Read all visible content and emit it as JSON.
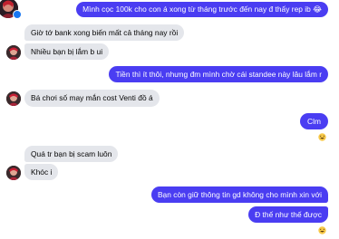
{
  "colors": {
    "outgoing": "#4a3df2",
    "incoming": "#e4e6eb",
    "incoming_text": "#050505",
    "outgoing_text": "#ffffff"
  },
  "messages": [
    {
      "side": "out",
      "text": "Mình cọc 100k cho con á xong từ tháng trước đến nay đ thấy rep ib 😂"
    },
    {
      "side": "in",
      "text": "Giờ tớ bank xong biến mất cả tháng nay rồi"
    },
    {
      "side": "in",
      "text": "Nhiều bạn bị lắm b ui"
    },
    {
      "side": "out",
      "text": "Tiền thì ít thôi, nhưng đm mình chờ cái standee này lâu lắm r"
    },
    {
      "side": "in",
      "text": "Bá chơi số may mắn cost Venti đồ á"
    },
    {
      "side": "out",
      "text": "Clm",
      "reaction": "😆"
    },
    {
      "side": "in",
      "text": "Quá tr bạn bị scam luôn"
    },
    {
      "side": "in",
      "text": "Khóc i"
    },
    {
      "side": "out",
      "text": "Bạn còn giữ thông tin gd không cho mình xin với"
    },
    {
      "side": "out",
      "text": "Đ thế như thế được",
      "reaction": "😆"
    }
  ],
  "icons": {
    "messenger_badge": "messenger-icon",
    "reaction": "laughing-emoji-icon"
  }
}
